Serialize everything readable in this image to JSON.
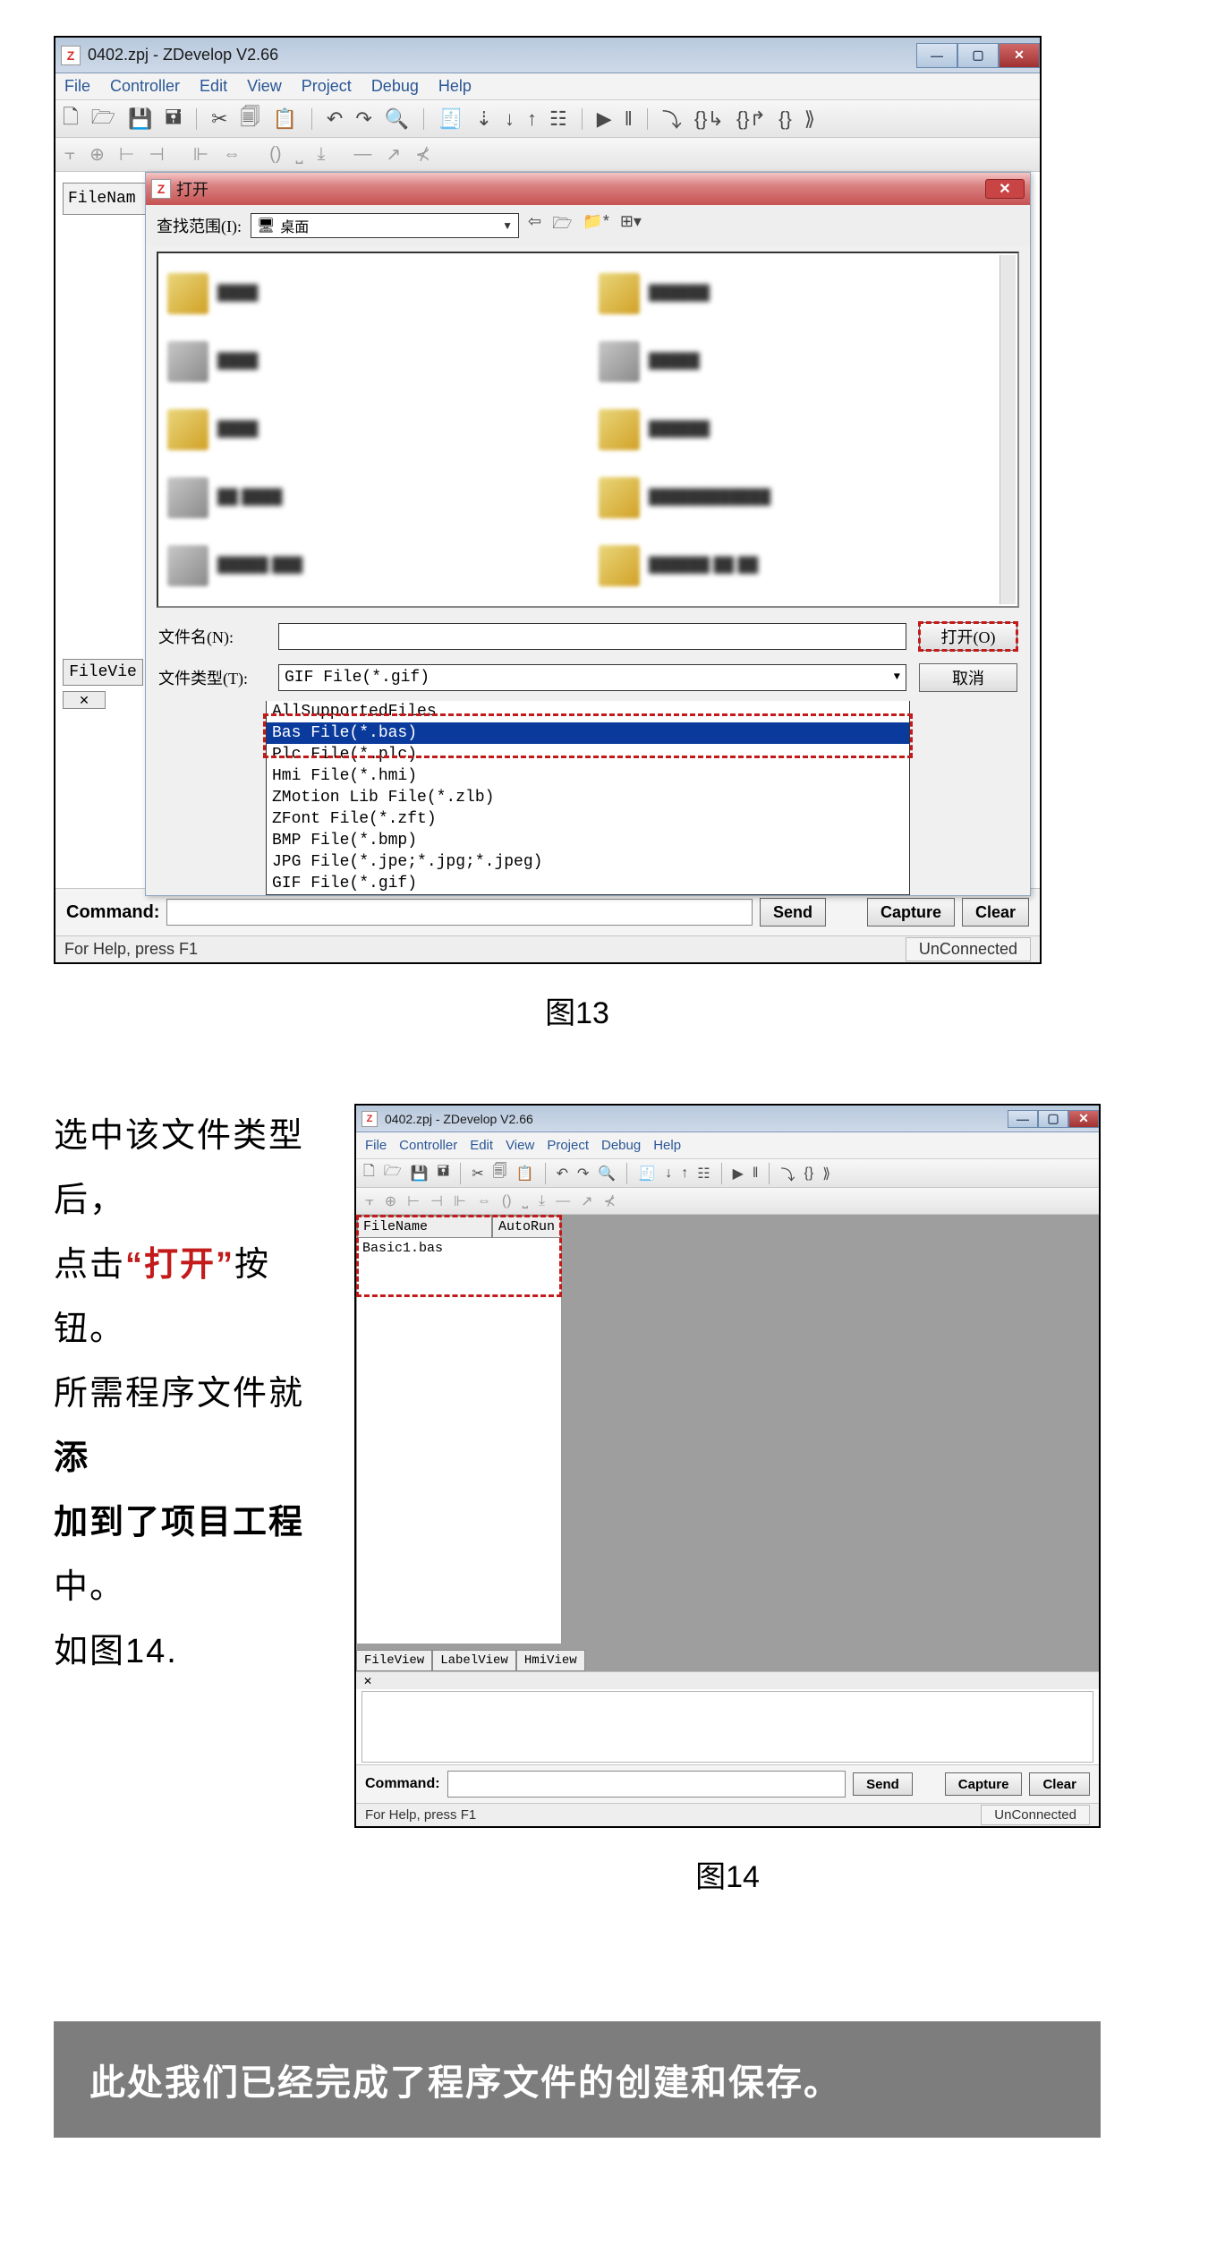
{
  "fig13": {
    "caption": "图13",
    "window_title": "0402.zpj - ZDevelop V2.66",
    "menus": [
      "File",
      "Controller",
      "Edit",
      "View",
      "Project",
      "Debug",
      "Help"
    ],
    "side_label": "FileNam",
    "fileview_tab": "FileVie",
    "open_dialog": {
      "title": "打开",
      "search_label": "查找范围(I):",
      "search_value": "桌面",
      "filename_label": "文件名(N):",
      "filetype_label": "文件类型(T):",
      "filetype_value": "GIF File(*.gif)",
      "open_btn": "打开(O)",
      "cancel_btn": "取消",
      "type_options": [
        "AllSupportedFiles",
        "Bas File(*.bas)",
        "Plc File(*.plc)",
        "Hmi File(*.hmi)",
        "ZMotion Lib File(*.zlb)",
        "ZFont File(*.zft)",
        "BMP File(*.bmp)",
        "JPG File(*.jpe;*.jpg;*.jpeg)",
        "GIF File(*.gif)"
      ],
      "selected_type_index": 1
    },
    "command_label": "Command:",
    "send_btn": "Send",
    "capture_btn": "Capture",
    "clear_btn": "Clear",
    "status_left": "For Help, press F1",
    "status_right": "UnConnected"
  },
  "fig14": {
    "caption": "图14",
    "window_title": "0402.zpj - ZDevelop V2.66",
    "menus": [
      "File",
      "Controller",
      "Edit",
      "View",
      "Project",
      "Debug",
      "Help"
    ],
    "side_headers": [
      "FileName",
      "AutoRun"
    ],
    "file_entry": "Basic1.bas",
    "side_tabs": [
      "FileView",
      "LabelView",
      "HmiView"
    ],
    "command_label": "Command:",
    "send_btn": "Send",
    "capture_btn": "Capture",
    "clear_btn": "Clear",
    "status_left": "For Help, press F1",
    "status_right": "UnConnected"
  },
  "description": {
    "t1": "选中该文件类型后，",
    "t2a": "点击",
    "t2b": "“打开”",
    "t2c": "按钮。",
    "t3a": "所需程序文件就",
    "t3b": "添",
    "t4a": "加到了项目工程",
    "t4b": "中。",
    "t5": "如图14."
  },
  "banner": "此处我们已经完成了程序文件的创建和保存。"
}
